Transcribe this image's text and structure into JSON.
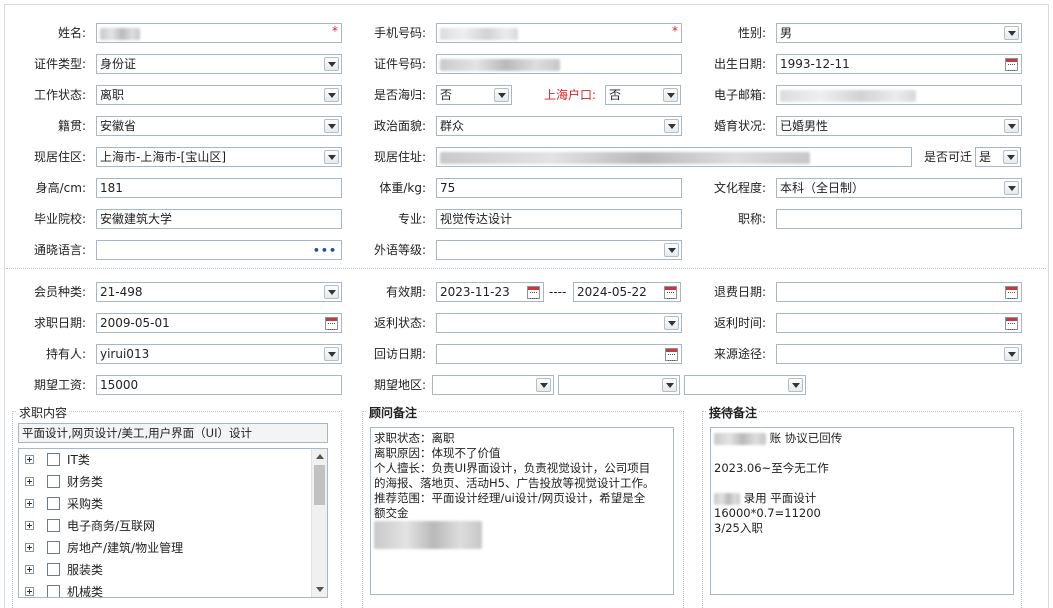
{
  "basic": {
    "name_label": "姓名:",
    "phone_label": "手机号码:",
    "gender_label": "性别:",
    "gender_value": "男",
    "id_type_label": "证件类型:",
    "id_type_value": "身份证",
    "id_number_label": "证件号码:",
    "birth_label": "出生日期:",
    "birth_value": "1993-12-11",
    "work_status_label": "工作状态:",
    "work_status_value": "离职",
    "overseas_label": "是否海归:",
    "overseas_value": "否",
    "shanghai_hukou_label": "上海户口:",
    "shanghai_hukou_value": "否",
    "email_label": "电子邮箱:",
    "origin_label": "籍贯:",
    "origin_value": "安徽省",
    "political_label": "政治面貌:",
    "political_value": "群众",
    "marital_label": "婚育状况:",
    "marital_value": "已婚男性",
    "residence_area_label": "现居住区:",
    "residence_area_value": "上海市-上海市-[宝山区]",
    "residence_address_label": "现居住址:",
    "relocate_label": "是否可迁",
    "relocate_value": "是",
    "height_label": "身高/cm:",
    "height_value": "181",
    "weight_label": "体重/kg:",
    "weight_value": "75",
    "education_label": "文化程度:",
    "education_value": "本科（全日制）",
    "school_label": "毕业院校:",
    "school_value": "安徽建筑大学",
    "major_label": "专业:",
    "major_value": "视觉传达设计",
    "title_label": "职称:",
    "title_value": "",
    "language_label": "通晓语言:",
    "language_value": "",
    "language_more": "•••",
    "foreign_level_label": "外语等级:",
    "foreign_level_value": ""
  },
  "membership": {
    "type_label": "会员种类:",
    "type_value": "21-498",
    "validity_label": "有效期:",
    "validity_start": "2023-11-23",
    "validity_sep": "----",
    "validity_end": "2024-05-22",
    "refund_date_label": "退费日期:",
    "refund_date_value": "",
    "job_date_label": "求职日期:",
    "job_date_value": "2009-05-01",
    "rebate_status_label": "返利状态:",
    "rebate_status_value": "",
    "rebate_time_label": "返利时间:",
    "rebate_time_value": "",
    "holder_label": "持有人:",
    "holder_value": "yirui013",
    "revisit_date_label": "回访日期:",
    "revisit_date_value": "",
    "source_label": "来源途径:",
    "source_value": "",
    "salary_label": "期望工资:",
    "salary_value": "15000",
    "region_label": "期望地区:"
  },
  "job_content": {
    "title": "求职内容",
    "summary": "平面设计,网页设计/美工,用户界面（UI）设计",
    "categories": [
      "IT类",
      "财务类",
      "采购类",
      "电子商务/互联网",
      "房地产/建筑/物业管理",
      "服装类",
      "机械类"
    ]
  },
  "advisor_notes": {
    "title": "顾问备注",
    "lines": [
      "求职状态：离职",
      "离职原因：体现不了价值",
      "个人擅长：负责UI界面设计，负责视觉设计，公司项目",
      "的海报、落地页、活动H5、广告投放等视觉设计工作。",
      "推荐范围：平面设计经理/ui设计/网页设计，希望是全",
      "额交金"
    ]
  },
  "reception_notes": {
    "title": "接待备注",
    "line1_suffix": "账 协议已回传",
    "line2": "2023.06~至今无工作",
    "line3_suffix": "录用 平面设计",
    "line4": "16000*0.7=11200",
    "line5": "3/25入职"
  },
  "colors": {
    "border": "#a9b6c4",
    "required": "#e02020",
    "label_red": "#e02020"
  }
}
